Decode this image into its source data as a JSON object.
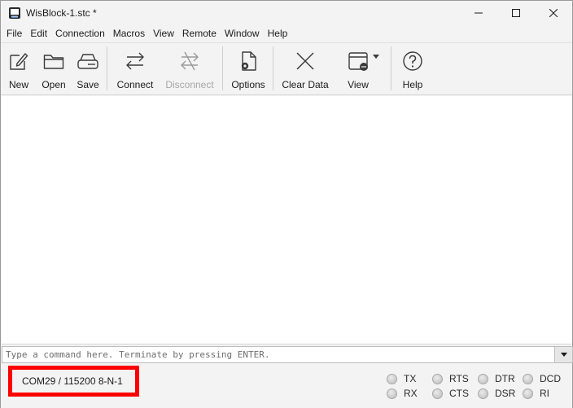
{
  "window": {
    "title": "WisBlock-1.stc *"
  },
  "menu": [
    "File",
    "Edit",
    "Connection",
    "Macros",
    "View",
    "Remote",
    "Window",
    "Help"
  ],
  "toolbar": {
    "new": "New",
    "open": "Open",
    "save": "Save",
    "connect": "Connect",
    "disconnect": "Disconnect",
    "options": "Options",
    "clear_data": "Clear Data",
    "view": "View",
    "help": "Help"
  },
  "command": {
    "placeholder": "Type a command here. Terminate by pressing ENTER."
  },
  "status": {
    "port": "COM29 / 115200 8-N-1",
    "leds": {
      "tx": "TX",
      "rx": "RX",
      "rts": "RTS",
      "cts": "CTS",
      "dtr": "DTR",
      "dsr": "DSR",
      "dcd": "DCD",
      "ri": "RI"
    }
  }
}
